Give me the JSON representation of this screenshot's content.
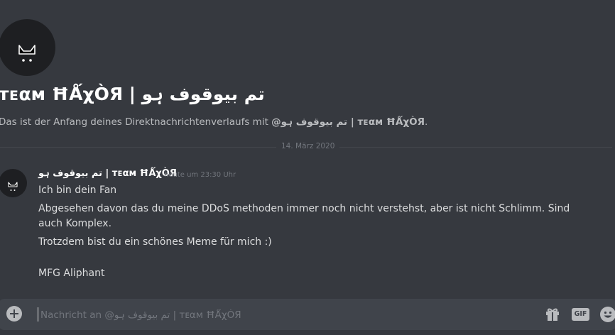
{
  "recipient": {
    "display_name": "تم بیوقوف ہو | ᴛᴇαм ĦǺχÒЯ",
    "avatar_icon": "black-cat-icon"
  },
  "header": {
    "intro_prefix": "Das ist der Anfang deines Direktnachrichtenverlaufs mit ",
    "intro_mention": "@تم بیوقوف ہو | ᴛᴇαм ĦǺχÒЯ",
    "intro_suffix": "."
  },
  "divider": {
    "date": "14. März 2020"
  },
  "messages": [
    {
      "author": "تم بیوقوف ہو | ᴛᴇαм ĦǺχÒЯ",
      "timestamp": "heute um 23:30 Uhr",
      "lines": [
        "Ich bin dein Fan",
        "Abgesehen davon das du meine DDoS methoden immer noch nicht verstehst, aber ist nicht Schlimm. Sind auch Komplex.",
        "Trotzdem bist du ein schönes Meme für mich :)",
        "MFG Aliphant"
      ]
    }
  ],
  "composer": {
    "placeholder": "Nachricht an @تم بیوقوف ہو | ᴛᴇαм ĦǺχÒЯ",
    "value": "",
    "add_icon": "plus-circle-icon",
    "gift_icon": "gift-icon",
    "gif_label": "GIF",
    "emoji_icon": "emoji-icon"
  },
  "colors": {
    "background": "#36393f",
    "composer_background": "#40444b",
    "text_primary": "#dcddde",
    "text_header": "#ffffff",
    "text_muted": "#72767d"
  }
}
